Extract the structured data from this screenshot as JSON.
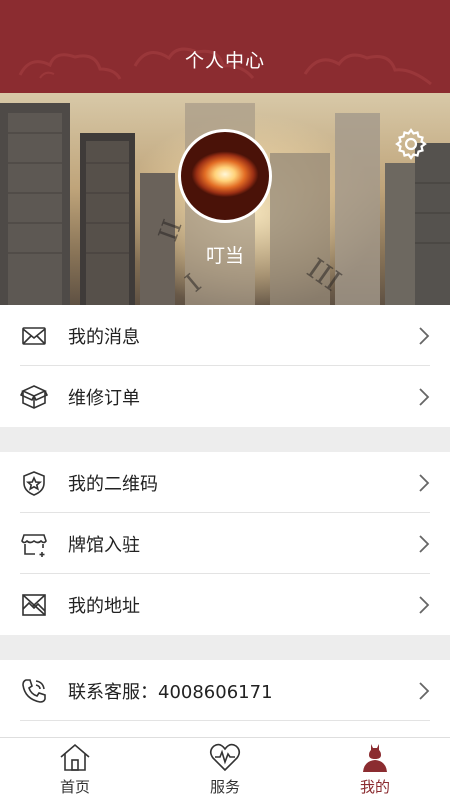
{
  "header": {
    "title": "个人中心"
  },
  "profile": {
    "username": "叮当"
  },
  "menu_groups": [
    {
      "items": [
        {
          "label": "我的消息",
          "icon": "envelope-icon"
        },
        {
          "label": "维修订单",
          "icon": "box-icon"
        }
      ]
    },
    {
      "items": [
        {
          "label": "我的二维码",
          "icon": "star-shield-icon"
        },
        {
          "label": " 牌馆入驻",
          "icon": "store-add-icon"
        },
        {
          "label": "我的地址",
          "icon": "map-icon"
        }
      ]
    },
    {
      "items": [
        {
          "label": "联系客服：4008606171",
          "icon": "phone-icon"
        }
      ]
    }
  ],
  "tabbar": {
    "tabs": [
      {
        "label": "首页",
        "icon": "home-icon"
      },
      {
        "label": "服务",
        "icon": "heart-pulse-icon"
      },
      {
        "label": "我的",
        "icon": "profile-icon"
      }
    ],
    "active_index": 2
  },
  "colors": {
    "brand": "#8b2c30",
    "background": "#ededed"
  }
}
